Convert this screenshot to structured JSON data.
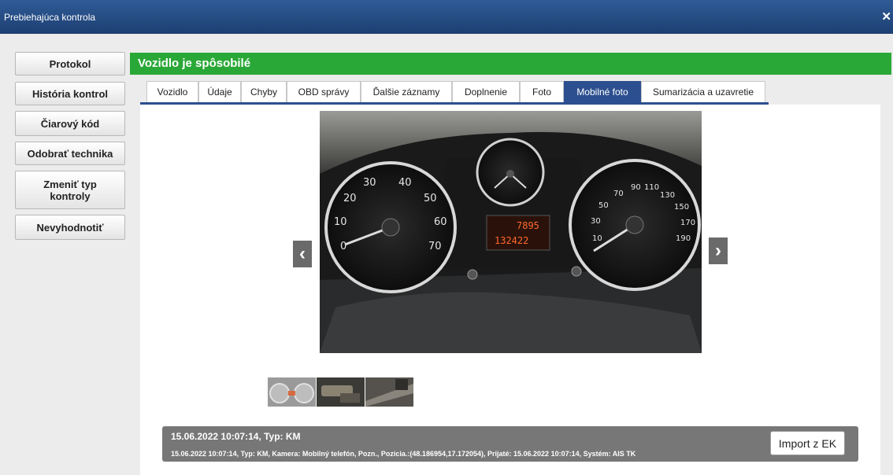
{
  "window": {
    "title": "Prebiehajúca kontrola",
    "close_symbol": "✕"
  },
  "sidebar": {
    "buttons": [
      {
        "label": "Protokol"
      },
      {
        "label": "História kontrol"
      },
      {
        "label": "Čiarový kód"
      },
      {
        "label": "Odobrať technika"
      },
      {
        "label": "Zmeniť typ kontroly"
      },
      {
        "label": "Nevyhodnotiť"
      }
    ]
  },
  "status": {
    "text": "Vozidlo je spôsobilé",
    "color": "#2aa837"
  },
  "tabs": [
    {
      "label": "Vozidlo"
    },
    {
      "label": "Údaje"
    },
    {
      "label": "Chyby"
    },
    {
      "label": "OBD správy"
    },
    {
      "label": "Ďalšie záznamy"
    },
    {
      "label": "Doplnenie"
    },
    {
      "label": "Foto"
    },
    {
      "label": "Mobilné foto",
      "active": true
    },
    {
      "label": "Sumarizácia a uzavretie"
    }
  ],
  "accent_color": "#2c4f8f",
  "gallery": {
    "prev_icon": "‹",
    "next_icon": "›",
    "dashboard": {
      "left_gauge_ticks": [
        "30",
        "40",
        "20",
        "50",
        "10",
        "60",
        "0",
        "70"
      ],
      "right_gauge_ticks": [
        "90",
        "110",
        "70",
        "130",
        "50",
        "150",
        "30",
        "170",
        "10",
        "190"
      ],
      "odometer_top": "7895",
      "odometer_bottom": "132422"
    }
  },
  "info": {
    "title": "15.06.2022 10:07:14, Typ: KM",
    "details": "15.06.2022 10:07:14, Typ: KM, Kamera: Mobilný telefón, Pozn., Pozicia.:(48.186954,17.172054), Prijaté: 15.06.2022 10:07:14, Systém: AIS TK",
    "import_label": "Import z EK"
  }
}
